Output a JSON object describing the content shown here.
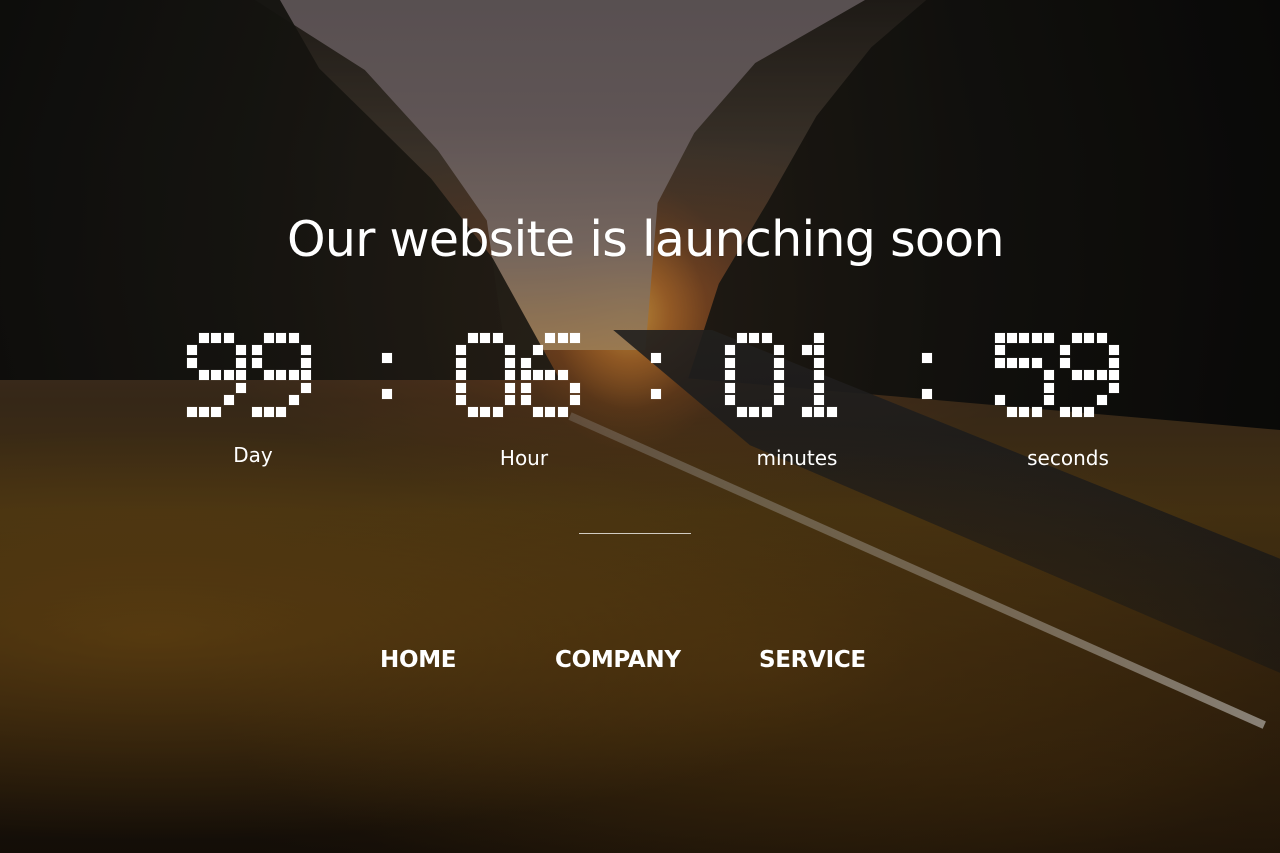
{
  "hero": {
    "headline": "Our website is launching soon"
  },
  "countdown": {
    "days": "99",
    "hours": "06",
    "minutes": "01",
    "seconds": "59",
    "labels": {
      "days": "Day",
      "hours": "Hour",
      "minutes": "minutes",
      "seconds": "seconds"
    },
    "separator": ":"
  },
  "nav": {
    "home": "HOME",
    "company": "COMPANY",
    "service": "SERVICE"
  }
}
